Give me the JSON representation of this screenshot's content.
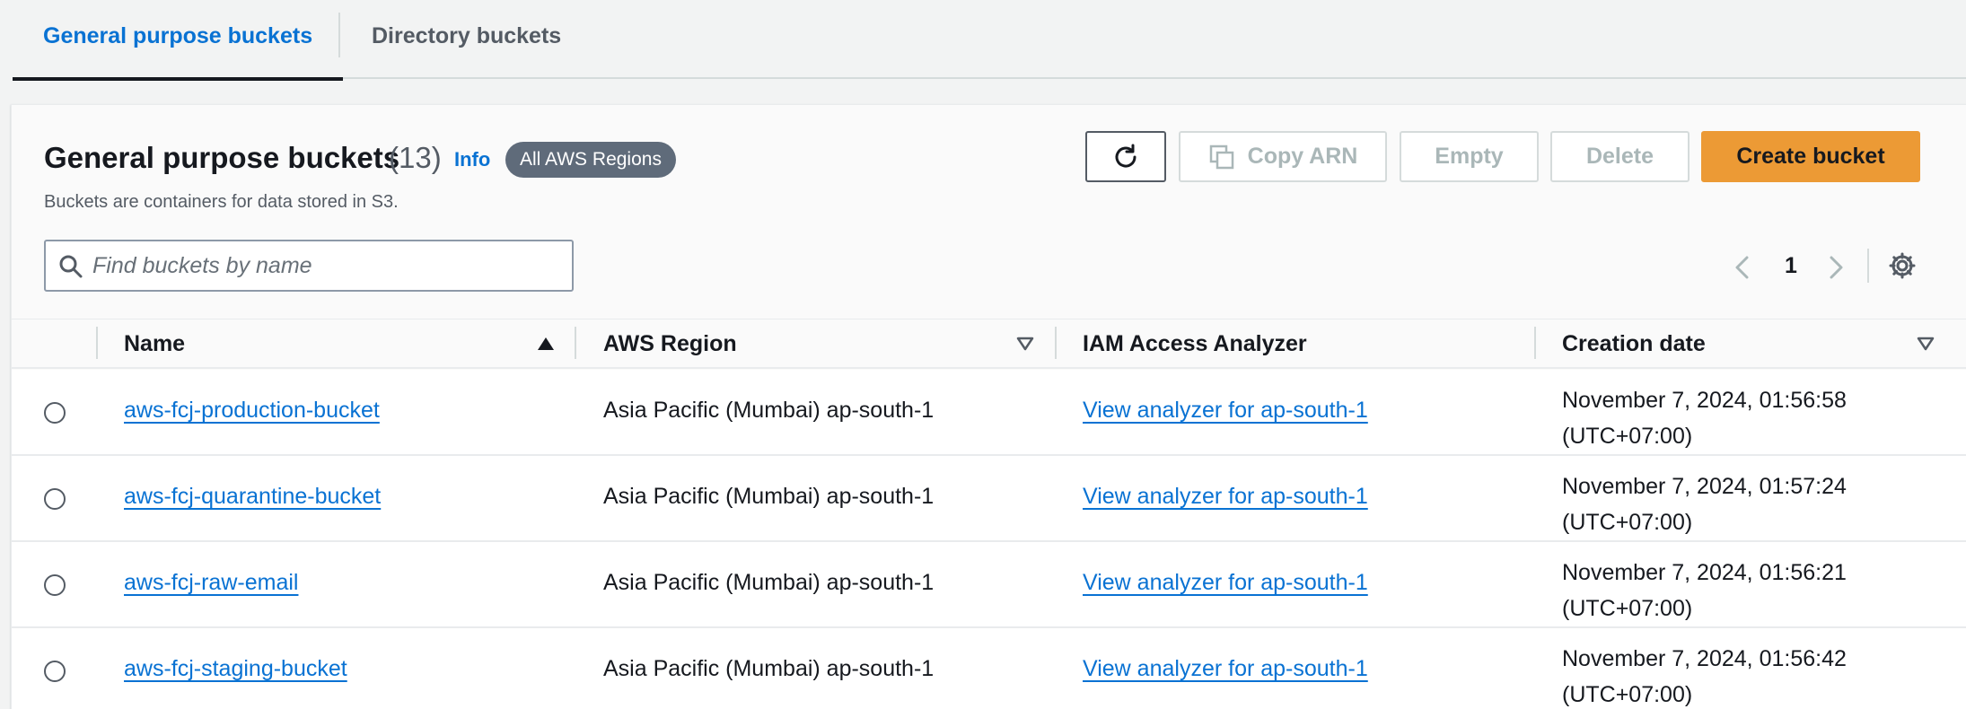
{
  "tabs": [
    {
      "label": "General purpose buckets",
      "active": true
    },
    {
      "label": "Directory buckets",
      "active": false
    }
  ],
  "header": {
    "title": "General purpose buckets",
    "count": "(13)",
    "info": "Info",
    "region_badge": "All AWS Regions",
    "description": "Buckets are containers for data stored in S3."
  },
  "toolbar": {
    "refresh_icon": "refresh-icon",
    "copy_arn_label": "Copy ARN",
    "empty_label": "Empty",
    "delete_label": "Delete",
    "create_label": "Create bucket"
  },
  "search": {
    "placeholder": "Find buckets by name",
    "value": ""
  },
  "pagination": {
    "current_page": "1"
  },
  "table": {
    "columns": [
      "Name",
      "AWS Region",
      "IAM Access Analyzer",
      "Creation date"
    ],
    "rows": [
      {
        "name": "aws-fcj-production-bucket",
        "region": "Asia Pacific (Mumbai) ap-south-1",
        "iam": "View analyzer for ap-south-1",
        "date": "November 7, 2024, 01:56:58 (UTC+07:00)"
      },
      {
        "name": "aws-fcj-quarantine-bucket",
        "region": "Asia Pacific (Mumbai) ap-south-1",
        "iam": "View analyzer for ap-south-1",
        "date": "November 7, 2024, 01:57:24 (UTC+07:00)"
      },
      {
        "name": "aws-fcj-raw-email",
        "region": "Asia Pacific (Mumbai) ap-south-1",
        "iam": "View analyzer for ap-south-1",
        "date": "November 7, 2024, 01:56:21 (UTC+07:00)"
      },
      {
        "name": "aws-fcj-staging-bucket",
        "region": "Asia Pacific (Mumbai) ap-south-1",
        "iam": "View analyzer for ap-south-1",
        "date": "November 7, 2024, 01:56:42 (UTC+07:00)"
      }
    ]
  },
  "colors": {
    "link": "#0972d3",
    "primary_button": "#ec9a35",
    "badge": "#5f6b7a"
  }
}
